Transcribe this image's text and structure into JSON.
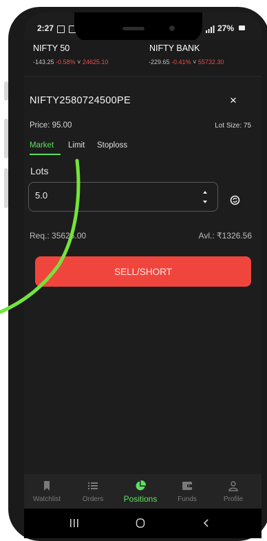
{
  "status_bar": {
    "time": "2:27",
    "battery": "27%"
  },
  "tickers": [
    {
      "name": "NIFTY 50",
      "change": "-143.25",
      "percent": "-0.58%",
      "arrow": "˅",
      "value": "24625.10"
    },
    {
      "name": "NIFTY BANK",
      "change": "-229.65",
      "percent": "-0.41%",
      "arrow": "˅",
      "value": "55732.30"
    }
  ],
  "order": {
    "symbol": "NIFTY2580724500PE",
    "close_icon": "×",
    "price": "Price: 95.00",
    "lot_size": "Lot Size: 75",
    "tabs": [
      "Market",
      "Limit",
      "Stoploss"
    ],
    "active_tab": "Market",
    "lots_label": "Lots",
    "lots_value": "5.0",
    "required": "Req.: 35625.00",
    "available": "Avl.: ₹1326.56",
    "action_label": "SELL/SHORT"
  },
  "bottom_nav": {
    "items": [
      {
        "label": "Watchlist",
        "icon": "bookmark-icon"
      },
      {
        "label": "Orders",
        "icon": "list-icon"
      },
      {
        "label": "Positions",
        "icon": "pie-chart-icon"
      },
      {
        "label": "Funds",
        "icon": "wallet-icon"
      },
      {
        "label": "Profile",
        "icon": "person-icon"
      }
    ],
    "active": "Positions"
  },
  "system_nav": {
    "recents_icon": "recents-icon",
    "home_icon": "home-icon",
    "back_icon": "back-icon"
  },
  "colors": {
    "accent_green": "#5de15d",
    "sell_red": "#f0453d",
    "negative_red": "#ee4a4a",
    "background": "#1d1d1d"
  }
}
